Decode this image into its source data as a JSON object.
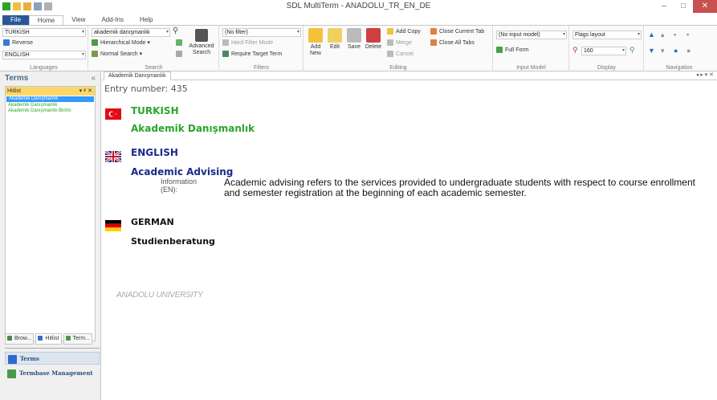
{
  "window": {
    "title": "SDL MultiTerm - ANADOLU_TR_EN_DE",
    "minimize": "–",
    "maximize": "□",
    "close": "✕"
  },
  "ribbon_tabs": [
    "File",
    "Home",
    "View",
    "Add-Ins",
    "Help"
  ],
  "ribbon": {
    "languages": {
      "source": "TURKISH",
      "reverse": "Reverse",
      "target": "ENGLISH",
      "label": "Languages"
    },
    "search": {
      "query": "akademik danışmanlık",
      "hierarchical": "Hierarchical Mode",
      "normal": "Normal Search",
      "advanced": "Advanced Search",
      "label": "Search"
    },
    "filters": {
      "filter": "(No filter)",
      "hard": "Hard Filter Mode",
      "require": "Require Target Term",
      "label": "Filters"
    },
    "editing": {
      "add_new": "Add New",
      "edit": "Edit",
      "save": "Save",
      "delete": "Delete",
      "add_copy": "Add Copy",
      "merge": "Merge",
      "cancel": "Cancel",
      "close_current": "Close Current Tab",
      "close_all": "Close All Tabs",
      "label": "Editing"
    },
    "input_model": {
      "model": "(No input model)",
      "full_form": "Full Form",
      "label": "Input Model"
    },
    "display": {
      "layout": "Flags layout",
      "zoom": "160",
      "label": "Display"
    },
    "navigation": {
      "label": "Navigation"
    }
  },
  "left_panel": {
    "title": "Terms",
    "collapse": "«",
    "hitlist": {
      "title": "Hitlist",
      "controls": "▾ ᵠ ✕",
      "items": [
        "Akademik Danışmanlık",
        "Akademik Danışmanlık",
        "Akademik Danışmanlık Birimi"
      ]
    },
    "tabs": [
      "Brow...",
      "Hitlist",
      "Term..."
    ],
    "nav_items": [
      "Terms",
      "Termbase Management"
    ]
  },
  "document": {
    "tab": "Akademik Danışmanlık",
    "tab_nav": "◂ ▸ ▾ ✕",
    "entry_number": "Entry number:  435",
    "languages": [
      {
        "name": "TURKISH",
        "term": "Akademik Danışmanlık",
        "color": "#2aa52a"
      },
      {
        "name": "ENGLISH",
        "term": "Academic Advising",
        "color": "#1a2a8a",
        "info_label": "Information",
        "info_lang": "(EN):",
        "definition": "Academic advising refers to the services provided to undergraduate students with respect to course enrollment and semester registration at the beginning of each academic semester."
      },
      {
        "name": "GERMAN",
        "term": "Studienberatung",
        "color": "#111111"
      }
    ],
    "footer": "ANADOLU UNIVERSITY"
  }
}
